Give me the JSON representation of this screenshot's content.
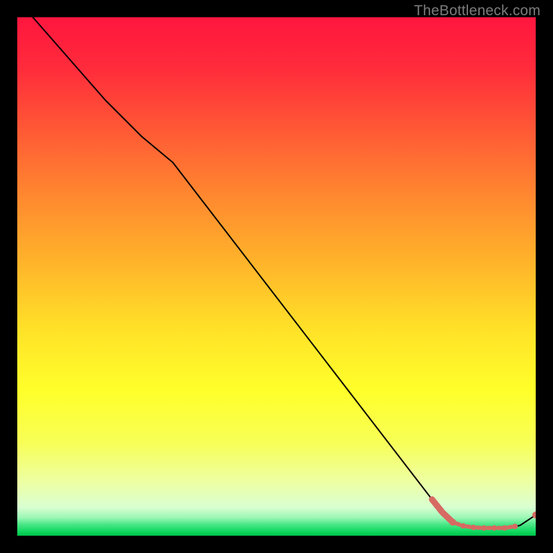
{
  "watermark": "TheBottleneck.com",
  "chart_data": {
    "type": "line",
    "title": "",
    "xlabel": "",
    "ylabel": "",
    "xlim": [
      0,
      100
    ],
    "ylim": [
      0,
      100
    ],
    "grid": false,
    "series": [
      {
        "name": "main-curve",
        "style": "solid-thin-black",
        "x": [
          3,
          10,
          17,
          24,
          30,
          40,
          50,
          60,
          70,
          80,
          82,
          85,
          90,
          95,
          97,
          100
        ],
        "y": [
          100,
          92,
          84,
          77,
          72,
          59,
          46,
          33,
          20,
          7,
          4.5,
          2.2,
          1.5,
          1.5,
          2.0,
          4.0
        ]
      },
      {
        "name": "emphasis-segment",
        "style": "thick-salmon",
        "x": [
          80,
          82,
          84
        ],
        "y": [
          7,
          4.5,
          2.6
        ]
      },
      {
        "name": "dotted-trough",
        "style": "dotted-salmon",
        "x": [
          84,
          86,
          88,
          90,
          92,
          94,
          96
        ],
        "y": [
          2.6,
          1.9,
          1.6,
          1.5,
          1.5,
          1.5,
          1.8
        ]
      },
      {
        "name": "end-point",
        "style": "point-salmon",
        "x": [
          100
        ],
        "y": [
          4.0
        ]
      }
    ],
    "background_gradient_stops": [
      {
        "offset": 0.0,
        "color": "#ff163e"
      },
      {
        "offset": 0.1,
        "color": "#ff2c3b"
      },
      {
        "offset": 0.22,
        "color": "#ff5a35"
      },
      {
        "offset": 0.35,
        "color": "#ff8a2f"
      },
      {
        "offset": 0.48,
        "color": "#ffb62a"
      },
      {
        "offset": 0.6,
        "color": "#ffe128"
      },
      {
        "offset": 0.72,
        "color": "#ffff2a"
      },
      {
        "offset": 0.82,
        "color": "#f8ff56"
      },
      {
        "offset": 0.9,
        "color": "#ecffa7"
      },
      {
        "offset": 0.945,
        "color": "#d9ffd1"
      },
      {
        "offset": 0.965,
        "color": "#9cf7b6"
      },
      {
        "offset": 0.978,
        "color": "#4be787"
      },
      {
        "offset": 0.992,
        "color": "#0fd85f"
      },
      {
        "offset": 1.0,
        "color": "#00c24a"
      }
    ],
    "colors": {
      "curve": "#000000",
      "accent": "#d76a62"
    }
  }
}
